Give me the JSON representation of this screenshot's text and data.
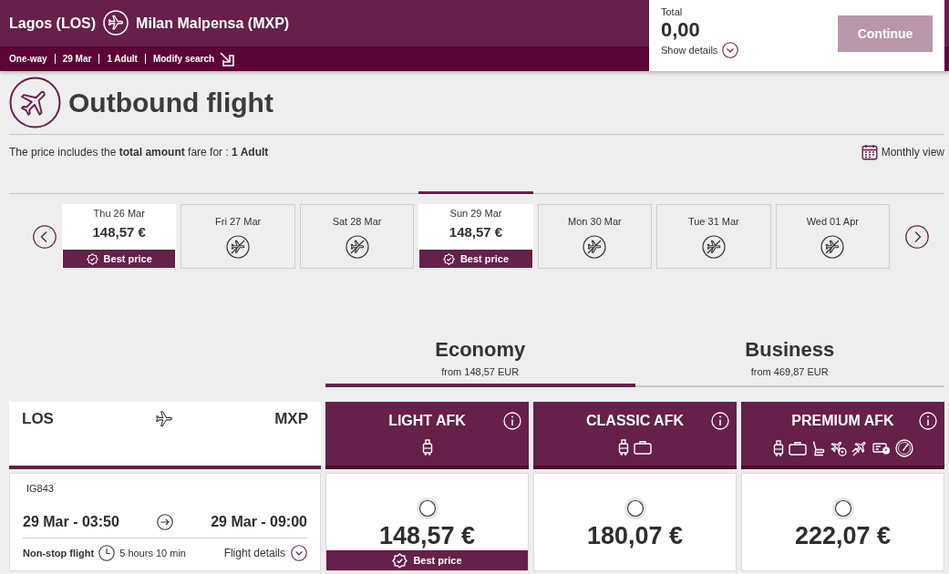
{
  "header": {
    "origin": "Lagos (LOS)",
    "destination": "Milan Malpensa (MXP)",
    "summary": [
      "One-way",
      "29 Mar",
      "1 Adult"
    ],
    "modify_link": "Modify search"
  },
  "basket": {
    "label": "Total",
    "amount": "0,00",
    "details_link": "Show details",
    "continue_button": {
      "label": "Continue",
      "disabled": true
    }
  },
  "page_title": "Outbound flight",
  "fare_note": "The price includes the **total amount** fare for : **1 Adult**",
  "monthly_view": "Monthly view",
  "dates": [
    {
      "label": "Thu 26 Mar",
      "price": "148,57 €",
      "badge": "Best price",
      "selected": false
    },
    {
      "label": "Fri 27 Mar",
      "selected": false
    },
    {
      "label": "Sat 28 Mar",
      "selected": false
    },
    {
      "label": "Sun 29 Mar",
      "price": "148,57 €",
      "badge": "Best price",
      "selected": true
    },
    {
      "label": "Mon 30 Mar",
      "selected": false
    },
    {
      "label": "Tue 31 Mar",
      "selected": false
    },
    {
      "label": "Wed 01 Apr",
      "selected": false
    }
  ],
  "cabins": [
    {
      "name": "Economy",
      "from": "from 148,57 EUR",
      "selected": true
    },
    {
      "name": "Business",
      "from": "from 469,87 EUR",
      "selected": false
    }
  ],
  "route": {
    "origin": "LOS",
    "destination": "MXP"
  },
  "fares": [
    {
      "name": "LIGHT AFK",
      "features": [
        {
          "kind": "cabin-bag"
        }
      ]
    },
    {
      "name": "CLASSIC AFK",
      "features": [
        {
          "kind": "cabin-bag"
        },
        {
          "kind": "checked-bag"
        }
      ]
    },
    {
      "name": "PREMIUM AFK",
      "features": [
        {
          "kind": "cabin-bag"
        },
        {
          "kind": "checked-bag"
        },
        {
          "kind": "seat"
        },
        {
          "kind": "flight-change"
        },
        {
          "kind": "departure"
        },
        {
          "kind": "ticket"
        },
        {
          "kind": "gauge"
        }
      ]
    }
  ],
  "flights": [
    {
      "number": "IG843",
      "departure": "29 Mar - 03:50",
      "arrival": "29 Mar - 09:00",
      "stops": "Non-stop flight",
      "duration": "5 hours 10 min",
      "details_link": "Flight details",
      "prices": [
        {
          "price": "148,57 €",
          "badge": "Best price",
          "selected": false
        },
        {
          "price": "180,07 €",
          "selected": false
        },
        {
          "price": "222,07 €",
          "selected": false
        }
      ]
    }
  ]
}
